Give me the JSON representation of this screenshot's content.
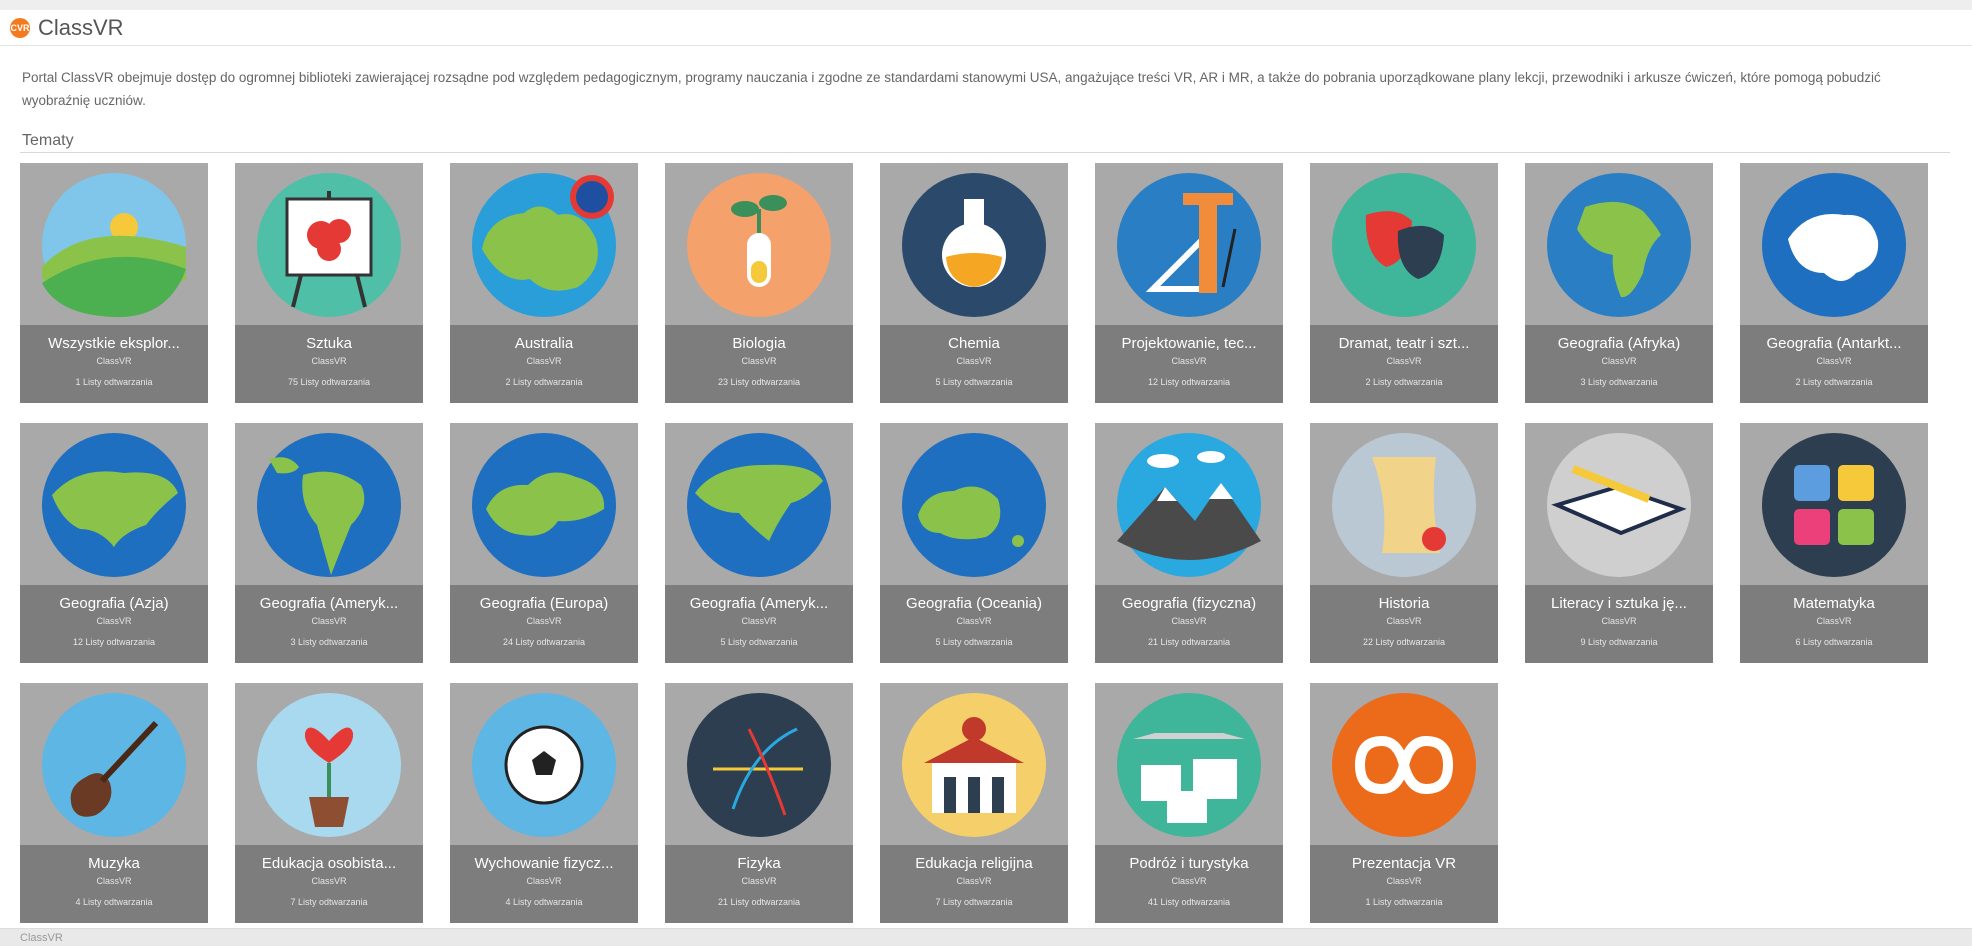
{
  "app": {
    "title": "ClassVR",
    "logo_text": "CVR"
  },
  "description": "Portal ClassVR obejmuje dostęp do ogromnej biblioteki zawierającej rozsądne pod względem pedagogicznym, programy nauczania i zgodne ze standardami stanowymi USA, angażujące treści VR, AR i MR, a także do pobrania uporządkowane plany lekcji, przewodniki i arkusze ćwiczeń, które pomogą pobudzić wyobraźnię uczniów.",
  "section_title": "Tematy",
  "footer_label": "ClassVR",
  "topics": [
    {
      "name": "Wszystkie eksplor...",
      "owner": "ClassVR",
      "count": "1 Listy odtwarzania",
      "icon": "landscape-icon"
    },
    {
      "name": "Sztuka",
      "owner": "ClassVR",
      "count": "75 Listy odtwarzania",
      "icon": "easel-icon"
    },
    {
      "name": "Australia",
      "owner": "ClassVR",
      "count": "2 Listy odtwarzania",
      "icon": "australia-map-icon"
    },
    {
      "name": "Biologia",
      "owner": "ClassVR",
      "count": "23 Listy odtwarzania",
      "icon": "test-tube-plant-icon"
    },
    {
      "name": "Chemia",
      "owner": "ClassVR",
      "count": "5 Listy odtwarzania",
      "icon": "flask-icon"
    },
    {
      "name": "Projektowanie, tec...",
      "owner": "ClassVR",
      "count": "12 Listy odtwarzania",
      "icon": "drafting-tools-icon"
    },
    {
      "name": "Dramat, teatr i szt...",
      "owner": "ClassVR",
      "count": "2 Listy odtwarzania",
      "icon": "theatre-masks-icon"
    },
    {
      "name": "Geografia (Afryka)",
      "owner": "ClassVR",
      "count": "3 Listy odtwarzania",
      "icon": "africa-map-icon"
    },
    {
      "name": "Geografia (Antarkt...",
      "owner": "ClassVR",
      "count": "2 Listy odtwarzania",
      "icon": "antarctica-map-icon"
    },
    {
      "name": "Geografia (Azja)",
      "owner": "ClassVR",
      "count": "12 Listy odtwarzania",
      "icon": "asia-map-icon"
    },
    {
      "name": "Geografia (Ameryk...",
      "owner": "ClassVR",
      "count": "3 Listy odtwarzania",
      "icon": "south-america-map-icon"
    },
    {
      "name": "Geografia (Europa)",
      "owner": "ClassVR",
      "count": "24 Listy odtwarzania",
      "icon": "europe-map-icon"
    },
    {
      "name": "Geografia (Ameryk...",
      "owner": "ClassVR",
      "count": "5 Listy odtwarzania",
      "icon": "north-america-map-icon"
    },
    {
      "name": "Geografia (Oceania)",
      "owner": "ClassVR",
      "count": "5 Listy odtwarzania",
      "icon": "oceania-map-icon"
    },
    {
      "name": "Geografia (fizyczna)",
      "owner": "ClassVR",
      "count": "21 Listy odtwarzania",
      "icon": "mountains-icon"
    },
    {
      "name": "Historia",
      "owner": "ClassVR",
      "count": "22 Listy odtwarzania",
      "icon": "scroll-icon"
    },
    {
      "name": "Literacy i sztuka ję...",
      "owner": "ClassVR",
      "count": "9 Listy odtwarzania",
      "icon": "book-pencil-icon"
    },
    {
      "name": "Matematyka",
      "owner": "ClassVR",
      "count": "6 Listy odtwarzania",
      "icon": "calculator-icon"
    },
    {
      "name": "Muzyka",
      "owner": "ClassVR",
      "count": "4 Listy odtwarzania",
      "icon": "guitar-icon"
    },
    {
      "name": "Edukacja osobista...",
      "owner": "ClassVR",
      "count": "7 Listy odtwarzania",
      "icon": "heart-plant-icon"
    },
    {
      "name": "Wychowanie fizycz...",
      "owner": "ClassVR",
      "count": "4 Listy odtwarzania",
      "icon": "soccer-ball-icon"
    },
    {
      "name": "Fizyka",
      "owner": "ClassVR",
      "count": "21 Listy odtwarzania",
      "icon": "physics-arrows-icon"
    },
    {
      "name": "Edukacja religijna",
      "owner": "ClassVR",
      "count": "7 Listy odtwarzania",
      "icon": "temple-icon"
    },
    {
      "name": "Podróż i turystyka",
      "owner": "ClassVR",
      "count": "41 Listy odtwarzania",
      "icon": "airplane-photos-icon"
    },
    {
      "name": "Prezentacja VR",
      "owner": "ClassVR",
      "count": "1 Listy odtwarzania",
      "icon": "infinity-icon"
    }
  ]
}
